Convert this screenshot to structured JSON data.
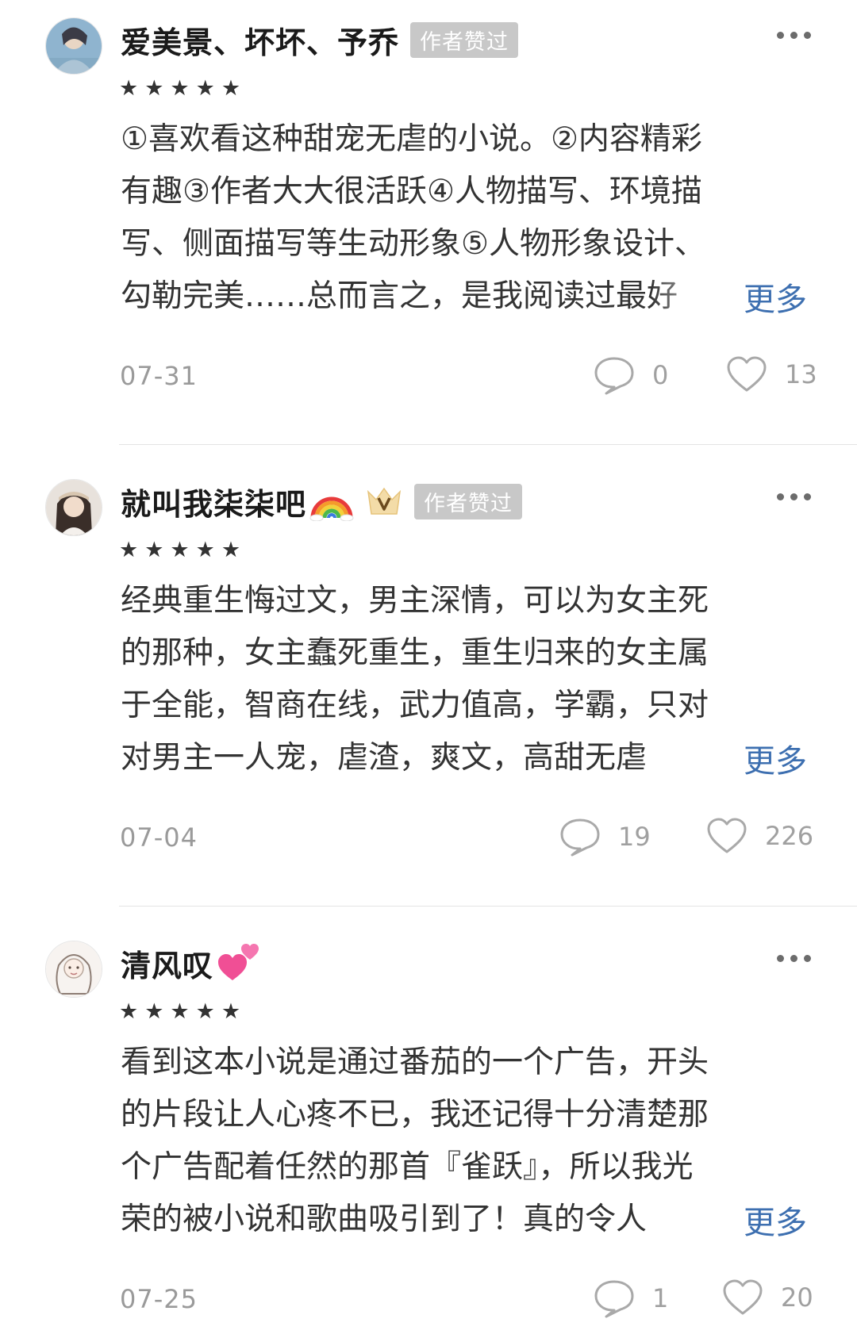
{
  "colors": {
    "link": "#3d6fb0",
    "badge_bg": "#c8c8c8",
    "meta_text": "#9a9a9a"
  },
  "comments": [
    {
      "username": "爱美景、坏坏、予乔",
      "badge": "作者赞过",
      "has_crown": false,
      "emoji": null,
      "stars": "★★★★★",
      "rating": 5,
      "lines": [
        "①喜欢看这种甜宠无虐的小说。②内容精彩",
        "有趣③作者大大很活跃④人物描写、环境描",
        "写、侧面描写等生动形象⑤人物形象设计、",
        "勾勒完美……总而言之，是我阅读过最好"
      ],
      "more": "更多",
      "date": "07-31",
      "reply_count": "0",
      "like_count": "13",
      "icons": [
        "more-icon",
        "comment-icon",
        "heart-icon"
      ]
    },
    {
      "username": "就叫我柒柒吧",
      "badge": "作者赞过",
      "has_crown": true,
      "emoji": "rainbow",
      "stars": "★★★★★",
      "rating": 5,
      "lines": [
        "经典重生悔过文，男主深情，可以为女主死",
        "的那种，女主蠢死重生，重生归来的女主属",
        "于全能，智商在线，武力值高，学霸，只对",
        "对男主一人宠，虐渣，爽文，高甜无虐"
      ],
      "more": "更多",
      "date": "07-04",
      "reply_count": "19",
      "like_count": "226",
      "icons": [
        "more-icon",
        "crown-icon",
        "comment-icon",
        "heart-icon"
      ]
    },
    {
      "username": "清风叹",
      "badge": null,
      "has_crown": false,
      "emoji": "two-hearts",
      "stars": "★★★★★",
      "rating": 5,
      "lines": [
        "看到这本小说是通过番茄的一个广告，开头",
        "的片段让人心疼不已，我还记得十分清楚那",
        "个广告配着任然的那首『雀跃』，所以我光",
        "荣的被小说和歌曲吸引到了！真的令人"
      ],
      "more": "更多",
      "date": "07-25",
      "reply_count": "1",
      "like_count": "20",
      "icons": [
        "more-icon",
        "comment-icon",
        "heart-icon"
      ]
    }
  ]
}
